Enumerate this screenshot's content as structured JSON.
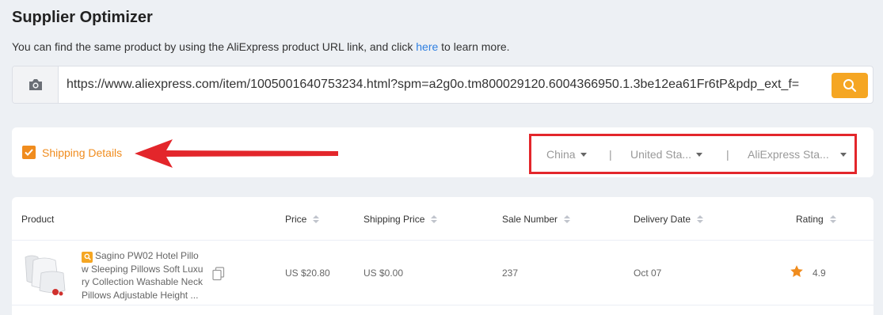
{
  "header": {
    "title": "Supplier Optimizer",
    "desc_before": "You can find the same product by using the AliExpress product URL link, and click ",
    "desc_link": "here",
    "desc_after": " to learn more."
  },
  "search": {
    "url_value": "https://www.aliexpress.com/item/1005001640753234.html?spm=a2g0o.tm800029120.6004366950.1.3be12ea61Fr6tP&pdp_ext_f=",
    "camera_icon": "camera-icon",
    "search_icon": "search-icon"
  },
  "shipping": {
    "checkbox_label": "Shipping Details",
    "checked": true,
    "ship_from": "China",
    "ship_to": "United Sta...",
    "method": "AliExpress Sta...",
    "separator": "|"
  },
  "table": {
    "columns": [
      "Product",
      "Price",
      "Shipping Price",
      "Sale Number",
      "Delivery Date",
      "Rating"
    ],
    "rows": [
      {
        "product_name": "Sagino PW02 Hotel Pillow Sleeping Pillows Soft Luxury Collection Washable Neck Pillows Adjustable Height ...",
        "product_lines": [
          "Sagino PW02 Hotel Pillo",
          "w Sleeping Pillows Soft Luxu",
          "ry Collection Washable Neck",
          "Pillows Adjustable Height ..."
        ],
        "price": "US $20.80",
        "shipping_price": "US $0.00",
        "sale_number": "237",
        "delivery_date": "Oct 07",
        "rating": "4.9"
      }
    ]
  },
  "colors": {
    "accent": "#f5a623",
    "checkbox": "#f08c1e",
    "link": "#2f7fe0",
    "highlight": "#e3262b"
  }
}
